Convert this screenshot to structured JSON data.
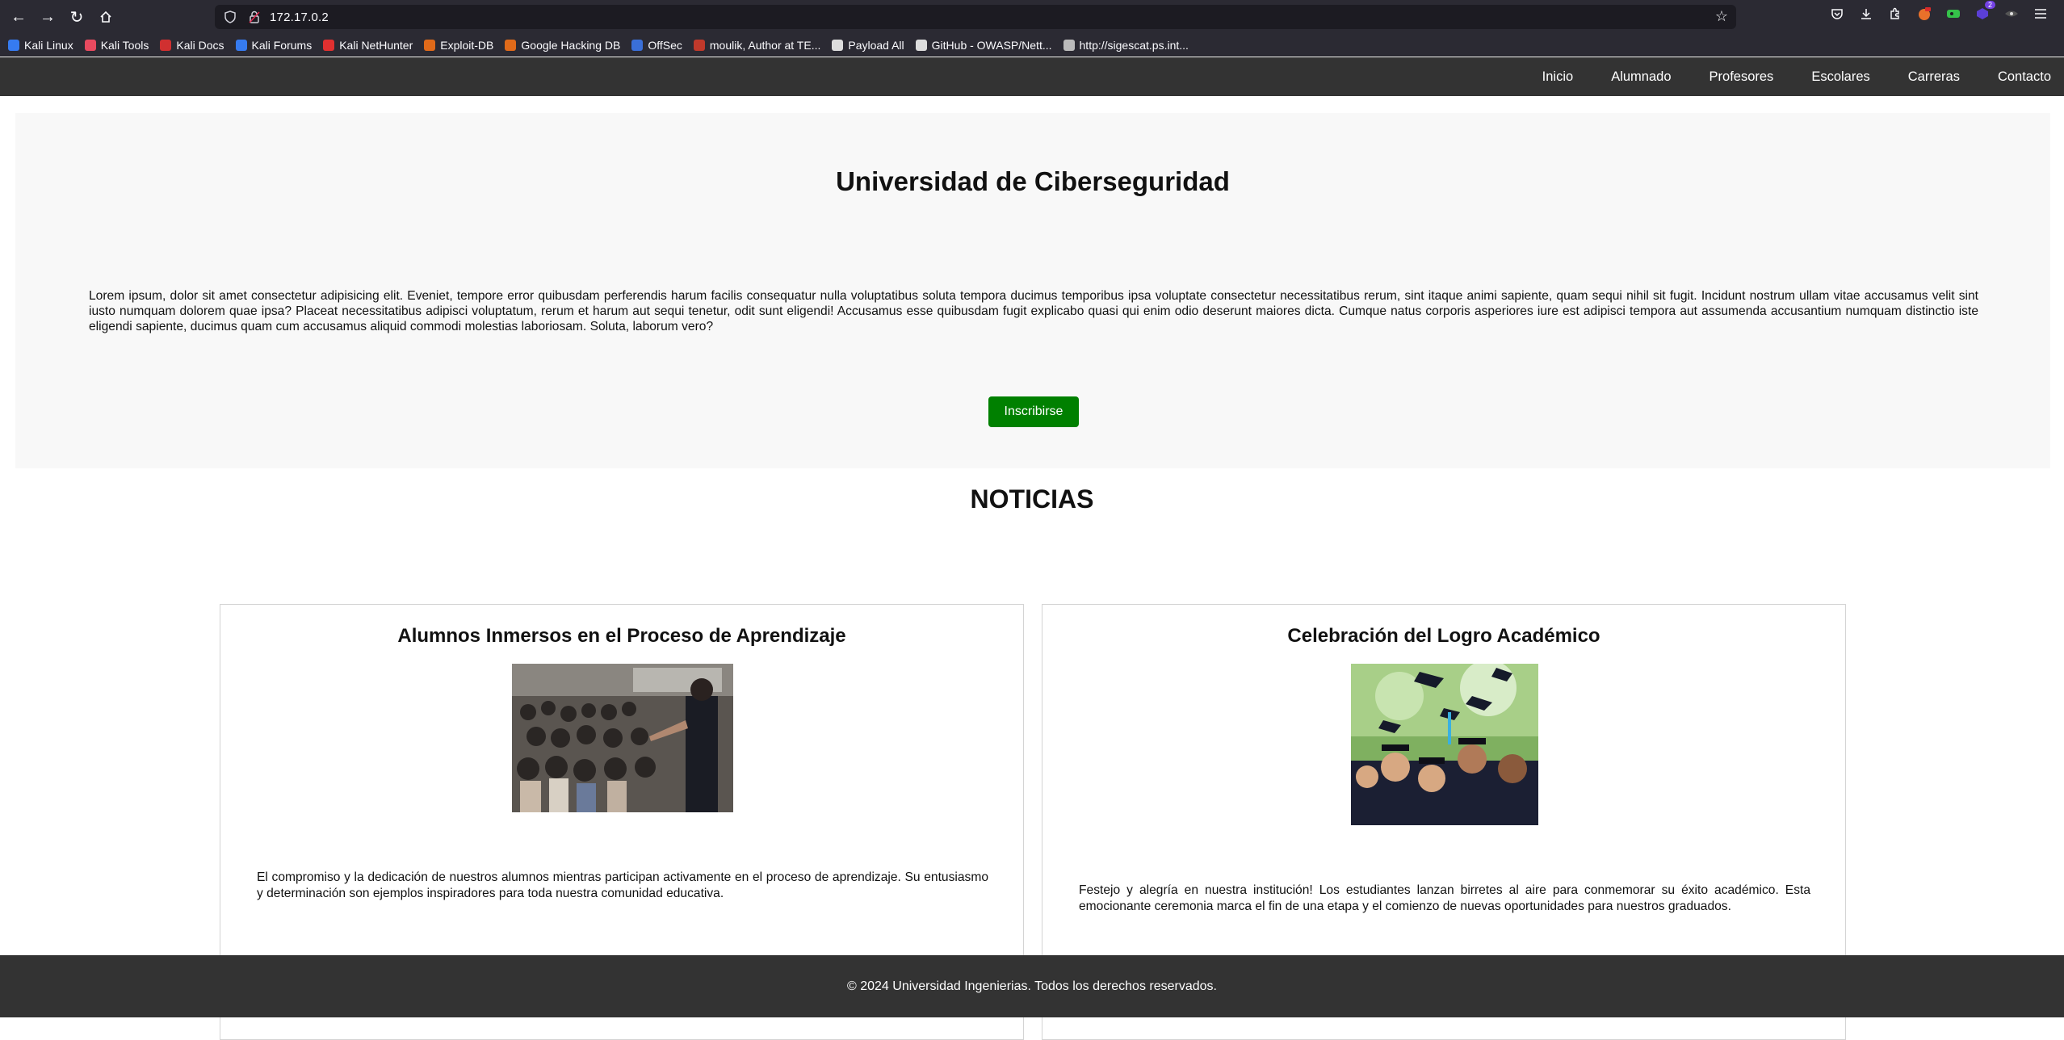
{
  "browser": {
    "url": "172.17.0.2",
    "bookmarks": [
      {
        "label": "Kali Linux",
        "color": "#367bf0"
      },
      {
        "label": "Kali Tools",
        "color": "#e84a5f"
      },
      {
        "label": "Kali Docs",
        "color": "#d03030"
      },
      {
        "label": "Kali Forums",
        "color": "#367bf0"
      },
      {
        "label": "Kali NetHunter",
        "color": "#e03030"
      },
      {
        "label": "Exploit-DB",
        "color": "#e06a1a"
      },
      {
        "label": "Google Hacking DB",
        "color": "#e06a1a"
      },
      {
        "label": "OffSec",
        "color": "#3a6fd8"
      },
      {
        "label": "moulik, Author at TE...",
        "color": "#c0392b"
      },
      {
        "label": "Payload All",
        "color": "#dddddd"
      },
      {
        "label": "GitHub - OWASP/Nett...",
        "color": "#dddddd"
      },
      {
        "label": "http://sigescat.ps.int...",
        "color": "#bbbbbb"
      }
    ],
    "ext_badge": "2"
  },
  "nav": {
    "items": [
      "Inicio",
      "Alumnado",
      "Profesores",
      "Escolares",
      "Carreras",
      "Contacto"
    ]
  },
  "hero": {
    "title": "Universidad de Ciberseguridad",
    "body": "Lorem ipsum, dolor sit amet consectetur adipisicing elit. Eveniet, tempore error quibusdam perferendis harum facilis consequatur nulla voluptatibus soluta tempora ducimus temporibus ipsa voluptate consectetur necessitatibus rerum, sint itaque animi sapiente, quam sequi nihil sit fugit. Incidunt nostrum ullam vitae accusamus velit sint iusto numquam dolorem quae ipsa? Placeat necessitatibus adipisci voluptatum, rerum et harum aut sequi tenetur, odit sunt eligendi! Accusamus esse quibusdam fugit explicabo quasi qui enim odio deserunt maiores dicta. Cumque natus corporis asperiores iure est adipisci tempora aut assumenda accusantium numquam distinctio iste eligendi sapiente, ducimus quam cum accusamus aliquid commodi molestias laboriosam. Soluta, laborum vero?",
    "button": "Inscribirse"
  },
  "news": {
    "title": "NOTICIAS",
    "cards": [
      {
        "title": "Alumnos Inmersos en el Proceso de Aprendizaje",
        "text": "El compromiso y la dedicación de nuestros alumnos mientras participan activamente en el proceso de aprendizaje. Su entusiasmo y determinación son ejemplos inspiradores para toda nuestra comunidad educativa."
      },
      {
        "title": "Celebración del Logro Académico",
        "text": "Festejo y alegría en nuestra institución! Los estudiantes lanzan birretes al aire para conmemorar su éxito académico. Esta emocionante ceremonia marca el fin de una etapa y el comienzo de nuevas oportunidades para nuestros graduados."
      }
    ]
  },
  "footer": {
    "text": "© 2024 Universidad Ingenierias. Todos los derechos reservados."
  }
}
